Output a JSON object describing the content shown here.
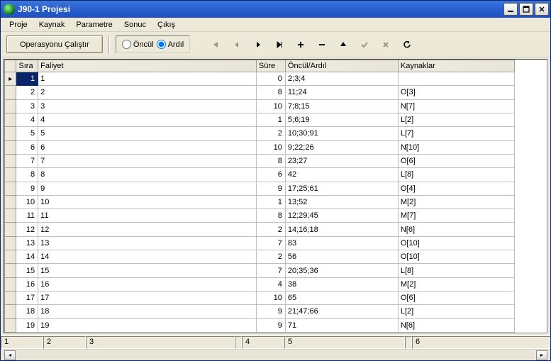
{
  "window": {
    "title": "J90-1 Projesi"
  },
  "menu": {
    "proje": "Proje",
    "kaynak": "Kaynak",
    "parametre": "Parametre",
    "sonuc": "Sonuc",
    "cikis": "Çıkış"
  },
  "toolbar": {
    "run_label": "Operasyonu Çalıştır",
    "radio_oncul": "Öncül",
    "radio_ardil": "Ardıl",
    "radio_selected": "ardil"
  },
  "grid": {
    "headers": {
      "sira": "Sıra",
      "faliyet": "Faliyet",
      "sure": "Süre",
      "oncul_ardil": "Öncül/Ardıl",
      "kaynaklar": "Kaynaklar"
    },
    "rows": [
      {
        "sira": 1,
        "faliyet": "1",
        "sure": 0,
        "oncul": "2;3;4",
        "kaynak": ""
      },
      {
        "sira": 2,
        "faliyet": "2",
        "sure": 8,
        "oncul": "11;24",
        "kaynak": "O[3]"
      },
      {
        "sira": 3,
        "faliyet": "3",
        "sure": 10,
        "oncul": "7;8;15",
        "kaynak": "N[7]"
      },
      {
        "sira": 4,
        "faliyet": "4",
        "sure": 1,
        "oncul": "5;6;19",
        "kaynak": "L[2]"
      },
      {
        "sira": 5,
        "faliyet": "5",
        "sure": 2,
        "oncul": "10;30;91",
        "kaynak": "L[7]"
      },
      {
        "sira": 6,
        "faliyet": "6",
        "sure": 10,
        "oncul": "9;22;26",
        "kaynak": "N[10]"
      },
      {
        "sira": 7,
        "faliyet": "7",
        "sure": 8,
        "oncul": "23;27",
        "kaynak": "O[6]"
      },
      {
        "sira": 8,
        "faliyet": "8",
        "sure": 6,
        "oncul": "42",
        "kaynak": "L[8]"
      },
      {
        "sira": 9,
        "faliyet": "9",
        "sure": 9,
        "oncul": "17;25;61",
        "kaynak": "O[4]"
      },
      {
        "sira": 10,
        "faliyet": "10",
        "sure": 1,
        "oncul": "13;52",
        "kaynak": "M[2]"
      },
      {
        "sira": 11,
        "faliyet": "11",
        "sure": 8,
        "oncul": "12;29;45",
        "kaynak": "M[7]"
      },
      {
        "sira": 12,
        "faliyet": "12",
        "sure": 2,
        "oncul": "14;16;18",
        "kaynak": "N[6]"
      },
      {
        "sira": 13,
        "faliyet": "13",
        "sure": 7,
        "oncul": "83",
        "kaynak": "O[10]"
      },
      {
        "sira": 14,
        "faliyet": "14",
        "sure": 2,
        "oncul": "56",
        "kaynak": "O[10]"
      },
      {
        "sira": 15,
        "faliyet": "15",
        "sure": 7,
        "oncul": "20;35;36",
        "kaynak": "L[8]"
      },
      {
        "sira": 16,
        "faliyet": "16",
        "sure": 4,
        "oncul": "38",
        "kaynak": "M[2]"
      },
      {
        "sira": 17,
        "faliyet": "17",
        "sure": 10,
        "oncul": "65",
        "kaynak": "O[6]"
      },
      {
        "sira": 18,
        "faliyet": "18",
        "sure": 9,
        "oncul": "21;47;66",
        "kaynak": "L[2]"
      },
      {
        "sira": 19,
        "faliyet": "19",
        "sure": 9,
        "oncul": "71",
        "kaynak": "N[6]"
      }
    ],
    "selected_row": 0
  },
  "statusbar": {
    "panels": [
      "1",
      "2",
      "3",
      "",
      "4",
      "5",
      "",
      "6"
    ]
  }
}
